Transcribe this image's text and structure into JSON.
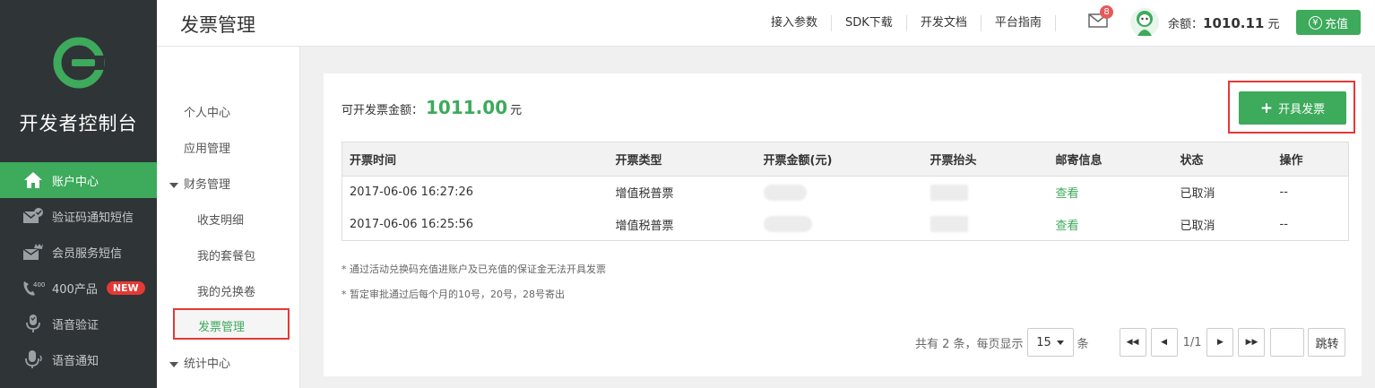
{
  "sidebar": {
    "brand": "开发者控制台",
    "items": [
      {
        "label": "账户中心",
        "icon": "home-icon"
      },
      {
        "label": "验证码通知短信",
        "icon": "mail-check-icon"
      },
      {
        "label": "会员服务短信",
        "icon": "mail-crown-icon"
      },
      {
        "label": "400产品",
        "icon": "phone-400-icon",
        "badge": "NEW"
      },
      {
        "label": "语音验证",
        "icon": "voice-verify-icon"
      },
      {
        "label": "语音通知",
        "icon": "microphone-icon"
      }
    ]
  },
  "header": {
    "title": "发票管理",
    "links": [
      "接入参数",
      "SDK下载",
      "开发文档",
      "平台指南"
    ],
    "mail_count": "8",
    "balance_label": "余额：",
    "balance_value": "1010.11",
    "balance_unit": "元",
    "recharge_label": "充值"
  },
  "subnav": {
    "personal": "个人中心",
    "apps": "应用管理",
    "finance": "财务管理",
    "ledger": "收支明细",
    "packages": "我的套餐包",
    "vouchers": "我的兑换卷",
    "invoices": "发票管理",
    "stats": "统计中心"
  },
  "main": {
    "amount_label": "可开发票金额：",
    "amount_value": "1011.00",
    "amount_unit": "元",
    "issue_button": "开具发票",
    "columns": [
      "开票时间",
      "开票类型",
      "开票金额(元)",
      "开票抬头",
      "邮寄信息",
      "状态",
      "操作"
    ],
    "rows": [
      {
        "time": "2017-06-06 16:27:26",
        "type": "增值税普票",
        "mail": "查看",
        "status": "已取消",
        "action": "--"
      },
      {
        "time": "2017-06-06 16:25:56",
        "type": "增值税普票",
        "mail": "查看",
        "status": "已取消",
        "action": "--"
      }
    ],
    "notes": [
      "* 通过活动兑换码充值进账户及已充值的保证金无法开具发票",
      "* 暂定审批通过后每个月的10号，20号，28号寄出"
    ]
  },
  "pager": {
    "total_text": "共有 2 条，每页显示",
    "page_size": "15",
    "unit": "条",
    "page_info": "1/1",
    "go_label": "跳转"
  },
  "colors": {
    "accent": "#3daa5c",
    "sidebar_bg": "#2f3437",
    "highlight": "#e53935"
  }
}
